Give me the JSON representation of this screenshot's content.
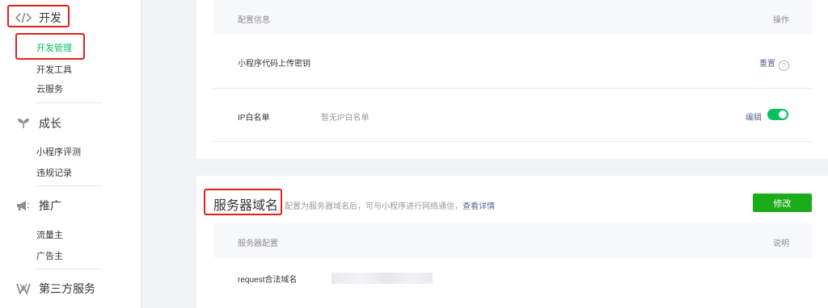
{
  "sidebar": {
    "dev": {
      "label": "开发",
      "icon": "code-icon",
      "items": [
        {
          "label": "开发管理",
          "active": true
        },
        {
          "label": "开发工具"
        },
        {
          "label": "云服务"
        }
      ]
    },
    "growth": {
      "label": "成长",
      "icon": "sprout-icon",
      "items": [
        {
          "label": "小程序评测"
        },
        {
          "label": "违规记录"
        }
      ]
    },
    "promo": {
      "label": "推广",
      "icon": "megaphone-icon",
      "items": [
        {
          "label": "流量主"
        },
        {
          "label": "广告主"
        }
      ]
    },
    "third": {
      "label": "第三方服务",
      "icon": "third-party-icon"
    }
  },
  "config_section": {
    "header_left": "配置信息",
    "header_right": "操作",
    "rows": [
      {
        "name": "小程序代码上传密钥",
        "value": "",
        "action": "重置"
      },
      {
        "name": "IP白名单",
        "value": "暂无IP白名单",
        "action": "编辑",
        "toggle_on": true
      }
    ]
  },
  "server_section": {
    "title": "服务器域名",
    "desc": "配置为服务器域名后，可与小程序进行网络通信，",
    "desc_link": "查看详情",
    "button": "修改",
    "header_left": "服务器配置",
    "header_right": "说明",
    "rows": [
      {
        "name": "request合法域名"
      }
    ]
  },
  "colors": {
    "accent": "#07c160",
    "button": "#1aad19",
    "link": "#576b95",
    "highlight": "#e0201c"
  }
}
